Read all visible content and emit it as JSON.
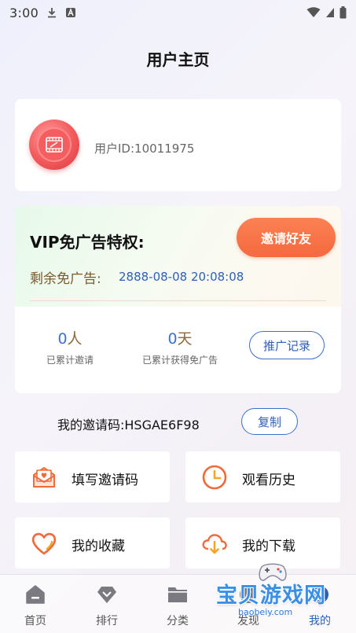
{
  "status_bar": {
    "time": "3:00"
  },
  "header": {
    "title": "用户主页"
  },
  "user": {
    "id_text": "用户ID:10011975"
  },
  "vip": {
    "title": "VIP免广告特权:",
    "invite_button": "邀请好友",
    "remain_label": "剩余免广告:",
    "remain_value": "2888-08-08 20:08:08",
    "invited_count": "0",
    "invited_unit": "人",
    "invited_label": "已累计邀请",
    "days_count": "0",
    "days_unit": "天",
    "days_label": "已累计获得免广告",
    "promo_button": "推广记录"
  },
  "invite_code": {
    "label": "我的邀请码:HSGAE6F98",
    "copy_button": "复制"
  },
  "tiles": {
    "fill_code": "填写邀请码",
    "history": "观看历史",
    "favorites": "我的收藏",
    "downloads": "我的下载"
  },
  "bottom_nav": {
    "home": "首页",
    "rank": "排行",
    "category": "分类",
    "feed": "发现",
    "me": "我的"
  },
  "watermark": {
    "text": "宝贝游戏网",
    "url": "baobeiy.com"
  },
  "colors": {
    "accent_blue": "#2f5fb5",
    "invite_orange": "#f5693f",
    "avatar_red": "#f2595b"
  }
}
